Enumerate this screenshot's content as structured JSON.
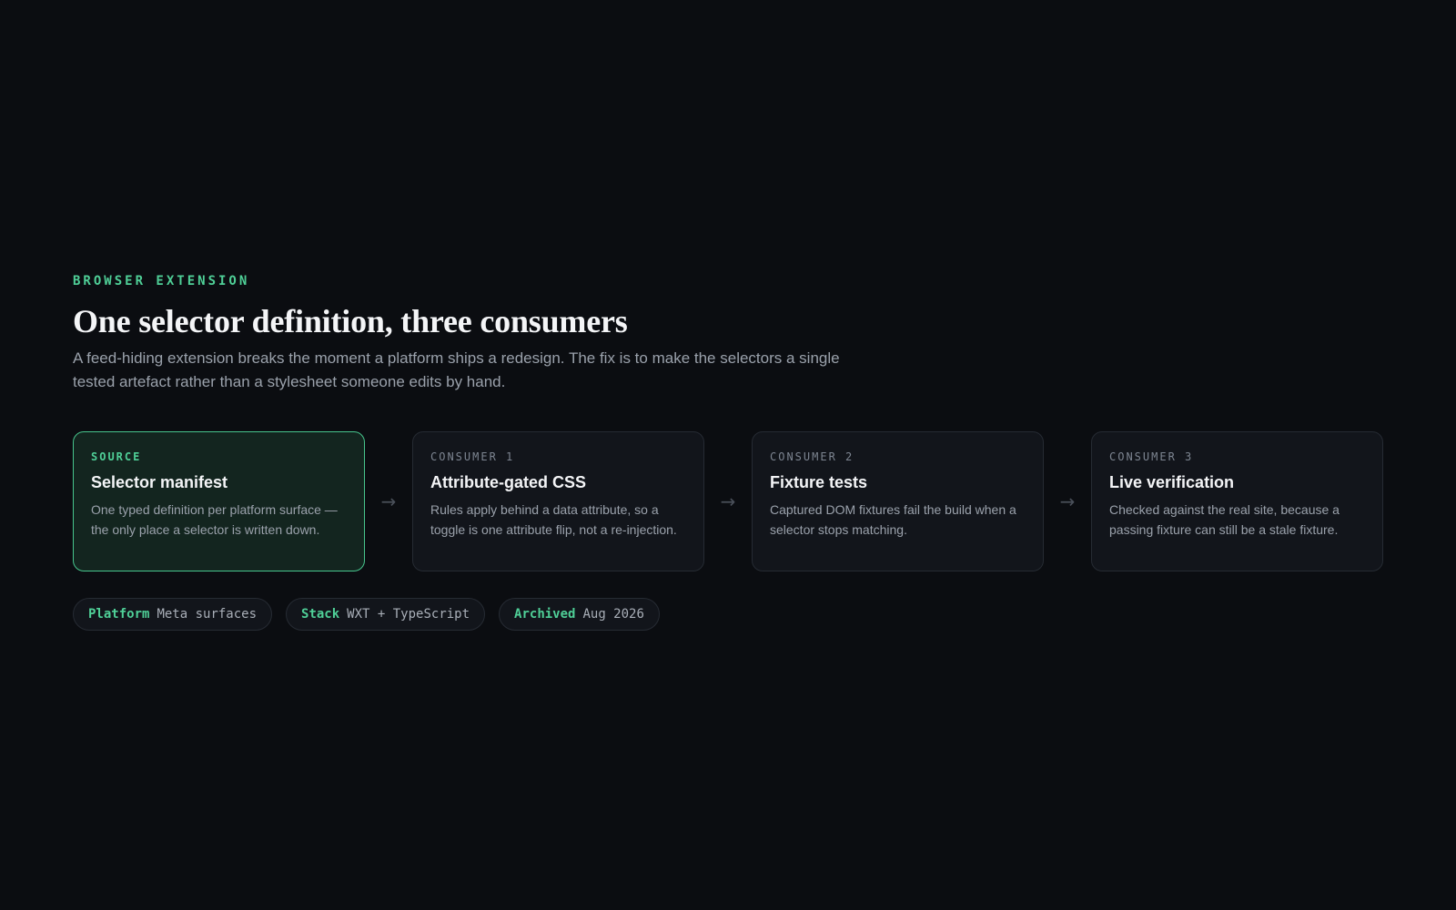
{
  "header": {
    "eyebrow": "BROWSER EXTENSION",
    "title": "One selector definition, three consumers",
    "lede": "A feed-hiding extension breaks the moment a platform ships a redesign. The fix is to make the selectors a single tested artefact rather than a stylesheet someone edits by hand."
  },
  "flow": {
    "arrow_glyph": "→",
    "cards": [
      {
        "kicker": "SOURCE",
        "title": "Selector manifest",
        "body": "One typed definition per platform surface — the only place a selector is written down."
      },
      {
        "kicker": "CONSUMER 1",
        "title": "Attribute-gated CSS",
        "body": "Rules apply behind a data attribute, so a toggle is one attribute flip, not a re-injection."
      },
      {
        "kicker": "CONSUMER 2",
        "title": "Fixture tests",
        "body": "Captured DOM fixtures fail the build when a selector stops matching."
      },
      {
        "kicker": "CONSUMER 3",
        "title": "Live verification",
        "body": "Checked against the real site, because a passing fixture can still be a stale fixture."
      }
    ]
  },
  "meta": [
    {
      "key": "Platform",
      "value": "Meta surfaces"
    },
    {
      "key": "Stack",
      "value": "WXT + TypeScript"
    },
    {
      "key": "Archived",
      "value": "Aug 2026"
    }
  ],
  "colors": {
    "background": "#0b0d11",
    "accent": "#4fcf97",
    "card_background": "#12151b",
    "source_card_background": "#13251f",
    "border": "#262b33"
  }
}
